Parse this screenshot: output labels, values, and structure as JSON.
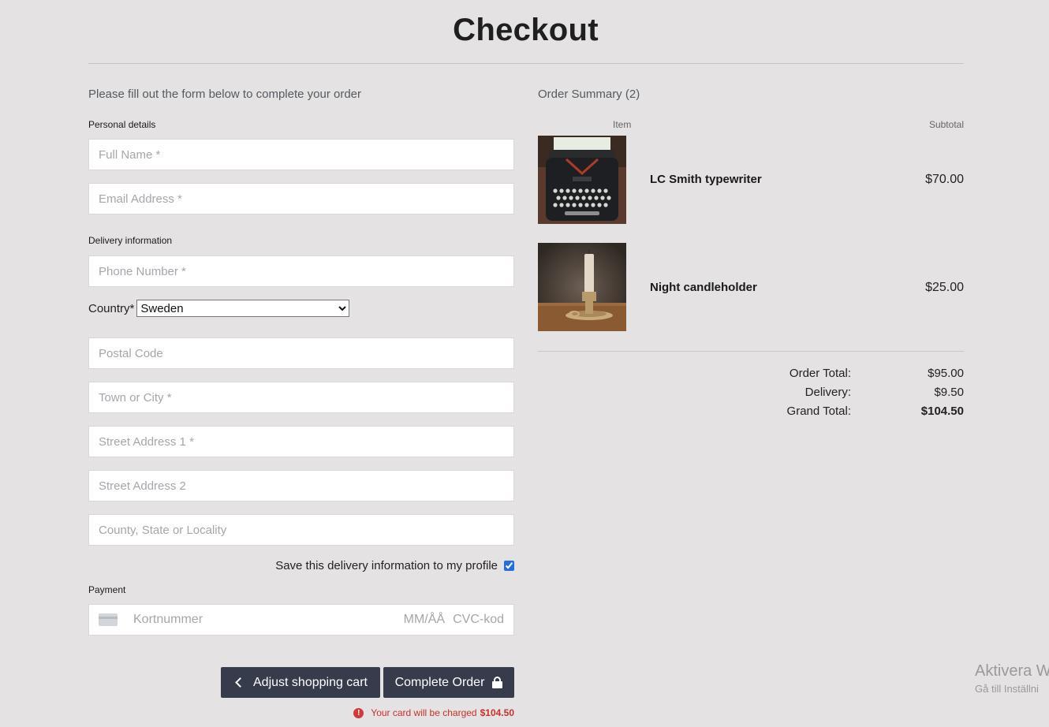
{
  "page": {
    "title": "Checkout"
  },
  "form": {
    "intro": "Please fill out the form below to complete your order",
    "personal_label": "Personal details",
    "full_name_placeholder": "Full Name *",
    "email_placeholder": "Email Address *",
    "delivery_label": "Delivery information",
    "phone_placeholder": "Phone Number *",
    "country_label": "Country*",
    "country_value": "Sweden",
    "postal_placeholder": "Postal Code",
    "town_placeholder": "Town or City *",
    "street1_placeholder": "Street Address 1 *",
    "street2_placeholder": "Street Address 2",
    "county_placeholder": "County, State or Locality",
    "save_label": "Save this delivery information to my profile",
    "save_checked": true,
    "payment_label": "Payment",
    "card_number_placeholder": "Kortnummer",
    "card_expiry_placeholder": "MM/ÅÅ",
    "card_cvc_placeholder": "CVC-kod",
    "card_icon": "credit-card-icon"
  },
  "buttons": {
    "back_label": "Adjust shopping cart",
    "complete_label": "Complete Order"
  },
  "charge": {
    "text": "Your card will be charged",
    "amount": "$104.50"
  },
  "summary": {
    "title": "Order Summary (2)",
    "col_item": "Item",
    "col_subtotal": "Subtotal",
    "items": [
      {
        "name": "LC Smith typewriter",
        "price": "$70.00"
      },
      {
        "name": "Night candleholder",
        "price": "$25.00"
      }
    ],
    "order_total_label": "Order Total:",
    "order_total": "$95.00",
    "delivery_label": "Delivery:",
    "delivery": "$9.50",
    "grand_total_label": "Grand Total:",
    "grand_total": "$104.50"
  },
  "os_overlay": {
    "line1": "Aktivera W",
    "line2": "Gå till Inställni"
  },
  "colors": {
    "background": "#e4e2e3",
    "button": "#363c4c",
    "error": "#c9302c"
  }
}
